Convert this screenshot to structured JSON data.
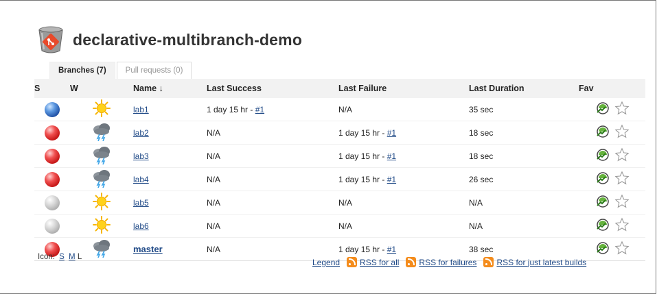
{
  "page": {
    "title": "declarative-multibranch-demo"
  },
  "tabs": [
    {
      "label": "Branches (7)",
      "active": true
    },
    {
      "label": "Pull requests (0)",
      "active": false
    }
  ],
  "table": {
    "headers": {
      "s": "S",
      "w": "W",
      "name": "Name ↓",
      "last_success": "Last Success",
      "last_failure": "Last Failure",
      "last_duration": "Last Duration",
      "fav": "Fav"
    },
    "rows": [
      {
        "status": "blue",
        "weather": "sunny-icon",
        "name": "lab1",
        "last_success_text": "1 day 15 hr - ",
        "last_success_link": "#1",
        "last_failure_text": "N/A",
        "last_failure_link": "",
        "last_duration": "35 sec"
      },
      {
        "status": "red",
        "weather": "storm-icon",
        "name": "lab2",
        "last_success_text": "N/A",
        "last_success_link": "",
        "last_failure_text": "1 day 15 hr - ",
        "last_failure_link": "#1",
        "last_duration": "18 sec"
      },
      {
        "status": "red",
        "weather": "storm-icon",
        "name": "lab3",
        "last_success_text": "N/A",
        "last_success_link": "",
        "last_failure_text": "1 day 15 hr - ",
        "last_failure_link": "#1",
        "last_duration": "18 sec"
      },
      {
        "status": "red",
        "weather": "storm-icon",
        "name": "lab4",
        "last_success_text": "N/A",
        "last_success_link": "",
        "last_failure_text": "1 day 15 hr - ",
        "last_failure_link": "#1",
        "last_duration": "26 sec"
      },
      {
        "status": "grey",
        "weather": "sunny-icon",
        "name": "lab5",
        "last_success_text": "N/A",
        "last_success_link": "",
        "last_failure_text": "N/A",
        "last_failure_link": "",
        "last_duration": "N/A"
      },
      {
        "status": "grey",
        "weather": "sunny-icon",
        "name": "lab6",
        "last_success_text": "N/A",
        "last_success_link": "",
        "last_failure_text": "N/A",
        "last_failure_link": "",
        "last_duration": "N/A"
      },
      {
        "status": "red",
        "weather": "storm-icon",
        "name": "master",
        "last_success_text": "N/A",
        "last_success_link": "",
        "last_failure_text": "1 day 15 hr - ",
        "last_failure_link": "#1",
        "last_duration": "38 sec"
      }
    ]
  },
  "icon_size": {
    "label": "Icon:",
    "options": [
      "S",
      "M",
      "L"
    ]
  },
  "footer": {
    "legend": "Legend",
    "rss_all": "RSS for all",
    "rss_failures": "RSS for failures",
    "rss_latest": "RSS for just latest builds"
  },
  "colors": {
    "link": "#204a87",
    "header_bg": "#f2f2f2",
    "rss": "#f48c1c"
  }
}
